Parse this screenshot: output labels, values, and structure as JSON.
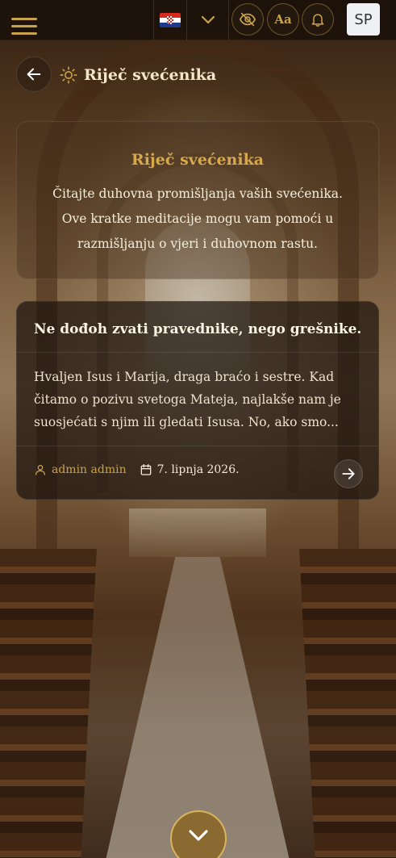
{
  "colors": {
    "accent": "#c9a24a",
    "title_gold": "#d7a94e",
    "topbar_bg": "#16100a"
  },
  "topbar": {
    "menu_icon": "hamburger-menu-icon",
    "language_flag": "croatia-flag",
    "language_dropdown_icon": "chevron-down-icon",
    "visibility_icon": "eye-off-icon",
    "font_size_label": "Aa",
    "notifications_icon": "bell-icon",
    "user_initials": "SP"
  },
  "header": {
    "back_icon": "arrow-left-icon",
    "title_icon": "sun-icon",
    "title": "Riječ svećenika"
  },
  "intro": {
    "heading": "Riječ svećenika",
    "lines": [
      "Čitajte duhovna promišljanja vaših svećenika.",
      "Ove kratke meditacije mogu vam pomoći u",
      "razmišljanju o vjeri i duhovnom rastu."
    ]
  },
  "posts": [
    {
      "title": "Ne dođoh zvati pravednike, nego grešnike.",
      "excerpt_lines": [
        "Hvaljen Isus i Marija, draga braćo i sestre. Kad",
        "čitamo o pozivu svetoga Mateja, najlakše nam je",
        "suosjećati s njim ili gledati Isusa. No, ako smo..."
      ],
      "author": "admin admin",
      "date": "7. lipnja 2026.",
      "author_icon": "user-icon",
      "date_icon": "calendar-icon",
      "read_icon": "arrow-right-icon"
    }
  ],
  "scroll_button_icon": "chevron-down-icon"
}
